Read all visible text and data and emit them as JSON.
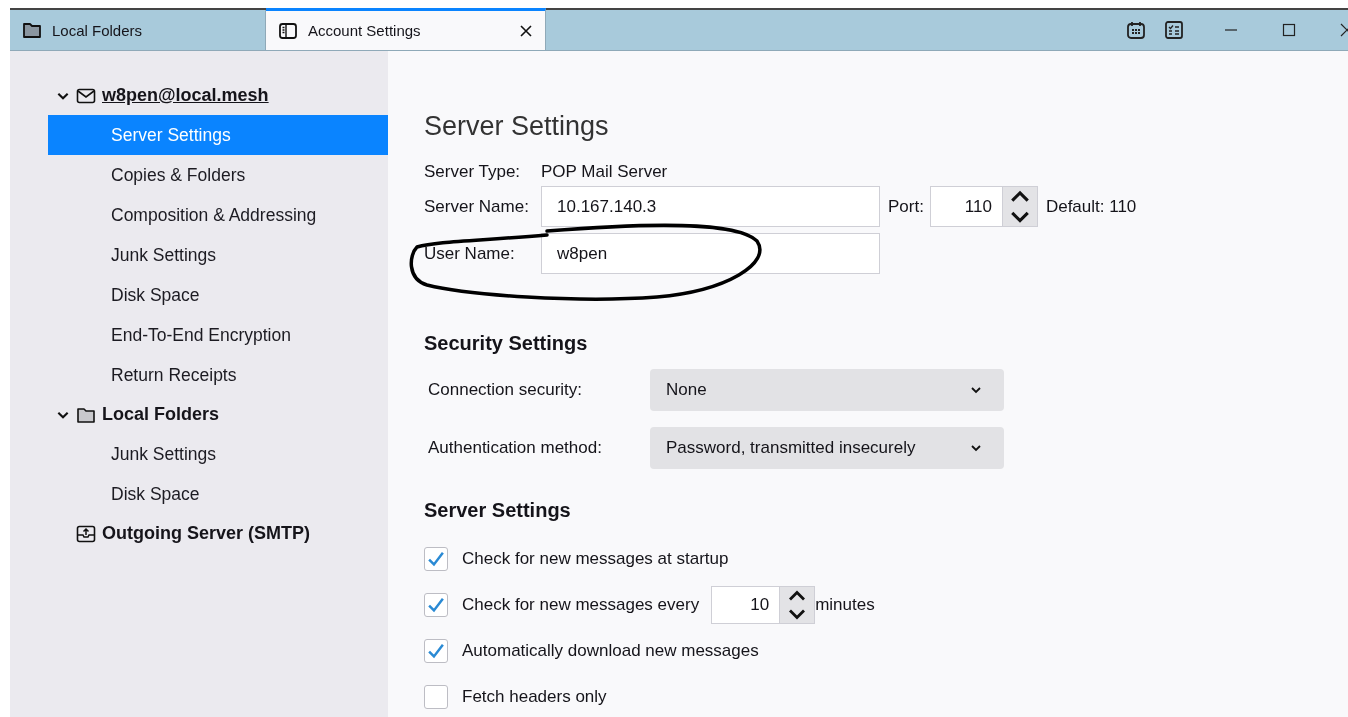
{
  "tabs": [
    {
      "label": "Local Folders",
      "kind": "folder",
      "selected": false
    },
    {
      "label": "Account Settings",
      "kind": "settings",
      "selected": true,
      "closable": true
    }
  ],
  "sidebar": {
    "items": [
      {
        "label": "w8pen@local.mesh",
        "kind": "account",
        "expanded": true,
        "children": [
          {
            "label": "Server Settings",
            "selected": true
          },
          {
            "label": "Copies & Folders",
            "selected": false
          },
          {
            "label": "Composition & Addressing",
            "selected": false
          },
          {
            "label": "Junk Settings",
            "selected": false
          },
          {
            "label": "Disk Space",
            "selected": false
          },
          {
            "label": "End-To-End Encryption",
            "selected": false
          },
          {
            "label": "Return Receipts",
            "selected": false
          }
        ]
      },
      {
        "label": "Local Folders",
        "kind": "folder",
        "expanded": true,
        "children": [
          {
            "label": "Junk Settings",
            "selected": false
          },
          {
            "label": "Disk Space",
            "selected": false
          }
        ]
      },
      {
        "label": "Outgoing Server (SMTP)",
        "kind": "outbox"
      }
    ]
  },
  "page": {
    "title": "Server Settings",
    "server_type": {
      "label": "Server Type:",
      "value": "POP Mail Server"
    },
    "server_name": {
      "label": "Server Name:",
      "value": "10.167.140.3"
    },
    "port": {
      "label": "Port:",
      "value": "110",
      "default": "Default: 110"
    },
    "user_name": {
      "label": "User Name:",
      "value": "w8pen"
    },
    "security": {
      "heading": "Security Settings",
      "selects": [
        {
          "label": "Connection security:",
          "value": "None"
        },
        {
          "label": "Authentication method:",
          "value": "Password, transmitted insecurely"
        }
      ]
    },
    "server": {
      "heading": "Server Settings",
      "options": [
        {
          "label": "Check for new messages at startup",
          "checked": true
        },
        {
          "label": "Check for new messages every",
          "checked": true,
          "value": "10",
          "suffix": "minutes"
        },
        {
          "label": "Automatically download new messages",
          "checked": true
        },
        {
          "label": "Fetch headers only",
          "checked": false
        }
      ]
    }
  }
}
